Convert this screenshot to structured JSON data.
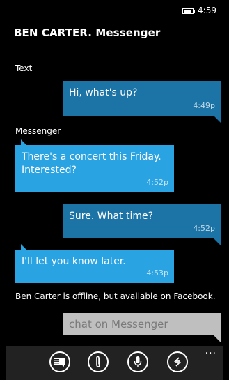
{
  "status_bar": {
    "time": "4:59",
    "battery_icon": "battery-icon"
  },
  "header": {
    "contact": "BEN CARTER.",
    "app": " Messenger"
  },
  "sections": {
    "text_label": "Text",
    "messenger_label": "Messenger"
  },
  "messages": [
    {
      "direction": "sent",
      "text": "Hi, what's up?",
      "time": "4:49p"
    },
    {
      "direction": "received",
      "text": "There's a concert this Friday. Interested?",
      "time": "4:52p"
    },
    {
      "direction": "sent",
      "text": "Sure. What time?",
      "time": "4:52p"
    },
    {
      "direction": "received",
      "text": "I'll let you know later.",
      "time": "4:53p"
    }
  ],
  "offline_note": "Ben Carter is offline, but available on Facebook.",
  "compose": {
    "placeholder": "chat on Messenger"
  },
  "app_bar": {
    "buttons": [
      {
        "icon": "send-icon"
      },
      {
        "icon": "attach-icon"
      },
      {
        "icon": "microphone-icon"
      },
      {
        "icon": "switch-icon"
      }
    ],
    "more": "..."
  },
  "colors": {
    "sent_bubble": "#1b73a6",
    "received_bubble": "#2aa3e2",
    "input_bg": "#bfbfbf",
    "app_bar_bg": "#222222"
  }
}
